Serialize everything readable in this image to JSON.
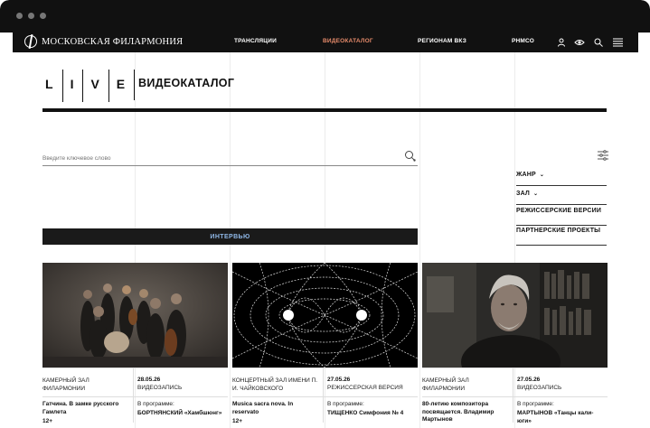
{
  "colors": {
    "nav_bg": "#111111",
    "active_link": "#e58a6a",
    "interview_text": "#8fb7e6",
    "accent_line": "#111111"
  },
  "nav": {
    "logo_text": "МОСКОВСКАЯ ФИЛАРМОНИЯ",
    "links": [
      "ТРАНСЛЯЦИИ",
      "ВИДЕОКАТАЛОГ",
      "РЕГИОНАМ ВКЗ",
      "РНМСО"
    ],
    "active_link": "ВИДЕОКАТАЛОГ",
    "icons": [
      "user-icon",
      "eye-icon",
      "search-icon",
      "menu-icon"
    ]
  },
  "header": {
    "live_letters": [
      "L",
      "I",
      "V",
      "E"
    ],
    "title": "ВИДЕОКАТАЛОГ"
  },
  "search": {
    "placeholder": "Введите ключевое слово",
    "value": ""
  },
  "filters": [
    {
      "label": "ЖАНР",
      "dropdown": true
    },
    {
      "label": "ЗАЛ",
      "dropdown": true
    },
    {
      "label": "РЕЖИССЕРСКИЕ ВЕРСИИ",
      "dropdown": false
    },
    {
      "label": "ПАРТНЕРСКИЕ ПРОЕКТЫ",
      "dropdown": false
    }
  ],
  "interview_label": "ИНТЕРВЬЮ",
  "cards": [
    {
      "hall": "КАМЕРНЫЙ ЗАЛ ФИЛАРМОНИИ",
      "date": "28.05.26",
      "kind": "ВИДЕОЗАПИСЬ",
      "title": "Гатчина. В замке русского Гамлета",
      "program_label": "В программе:",
      "program": "БОРТНЯНСКИЙ «Хамбшюнг»",
      "age": "12+"
    },
    {
      "hall": "КОНЦЕРТНЫЙ ЗАЛ ИМЕНИ П. И. ЧАЙКОВСКОГО",
      "date": "27.05.26",
      "kind": "РЕЖИССЕРСКАЯ ВЕРСИЯ",
      "title": "Musica sacra nova. In reservato",
      "program_label": "В программе:",
      "program": "ТИЩЕНКО Симфония № 4",
      "age": "12+"
    },
    {
      "hall": "КАМЕРНЫЙ ЗАЛ ФИЛАРМОНИИ",
      "date": "27.05.26",
      "kind": "ВИДЕОЗАПИСЬ",
      "title": "80-летию композитора посвящается. Владимир Мартынов",
      "program_label": "В программе:",
      "program": "МАРТЫНОВ «Танцы кали-юги»",
      "age": ""
    }
  ]
}
